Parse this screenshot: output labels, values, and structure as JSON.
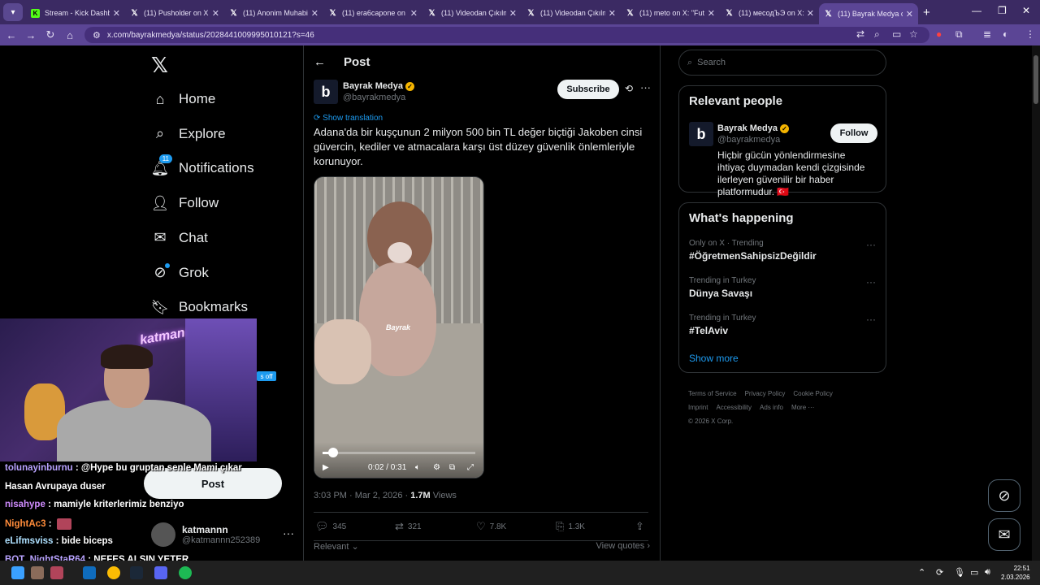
{
  "browser": {
    "tabs": [
      {
        "title": "Stream - Kick Dashbo",
        "favicon": "kick-icon",
        "active": false
      },
      {
        "title": "(11) Pusholder on X: '",
        "favicon": "x-icon",
        "active": false
      },
      {
        "title": "(11) Anonim Muhabir",
        "favicon": "x-icon",
        "active": false
      },
      {
        "title": "(11) era6capone on X",
        "favicon": "x-icon",
        "active": false
      },
      {
        "title": "(11) Videodan Çıkılm",
        "favicon": "x-icon",
        "active": false
      },
      {
        "title": "(11) Videodan Çıkılm",
        "favicon": "x-icon",
        "active": false
      },
      {
        "title": "(11) meto on X: \"Futb",
        "favicon": "x-icon",
        "active": false
      },
      {
        "title": "(11) месодЪЭ on X: '",
        "favicon": "x-icon",
        "active": false
      },
      {
        "title": "(11) Bayrak Medya on",
        "favicon": "x-icon",
        "active": true
      }
    ],
    "url": "x.com/bayrakmedya/status/2028441009995010121?s=46"
  },
  "nav": {
    "items": [
      {
        "label": "Home",
        "icon": "home-icon"
      },
      {
        "label": "Explore",
        "icon": "search-icon"
      },
      {
        "label": "Notifications",
        "icon": "bell-icon",
        "badge": "11"
      },
      {
        "label": "Follow",
        "icon": "follow-icon"
      },
      {
        "label": "Chat",
        "icon": "mail-icon"
      },
      {
        "label": "Grok",
        "icon": "grok-icon"
      },
      {
        "label": "Bookmarks",
        "icon": "bookmark-icon"
      }
    ],
    "post_button": "Post",
    "account": {
      "name": "katmannn",
      "handle": "@katmannn252389"
    }
  },
  "post": {
    "header": "Post",
    "author": {
      "name": "Bayrak Medya",
      "handle": "@bayrakmedya",
      "avatar_letter": "b"
    },
    "subscribe": "Subscribe",
    "show_translation": "Show translation",
    "text": "Adana'da bir kuşçunun 2 milyon 500 bin TL değer biçtiği Jakoben cinsi güvercin, kediler ve atmacalara karşı üst düzey güvenlik önlemleriyle korunuyor.",
    "video": {
      "watermark": "Bayrak",
      "time": "0:02 / 0:31",
      "progress": 0.07
    },
    "time": "3:03 PM · Mar 2, 2026 ·",
    "views": "1.7M",
    "views_label": "Views",
    "actions": {
      "replies": "345",
      "reposts": "321",
      "likes": "7.8K",
      "bookmarks": "1.3K"
    },
    "relevant": "Relevant",
    "view_quotes": "View quotes"
  },
  "right": {
    "search_placeholder": "Search",
    "relevant_people": {
      "title": "Relevant people",
      "name": "Bayrak Medya",
      "handle": "@bayrakmedya",
      "follow": "Follow",
      "bio": "Hiçbir gücün yönlendirmesine ihtiyaç duymadan kendi çizgisinde ilerleyen güvenilir bir haber platformudur. 🇹🇷"
    },
    "happening": {
      "title": "What's happening",
      "trends": [
        {
          "context": "Only on X · Trending",
          "name": "#ÖğretmenSahipsizDeğildir"
        },
        {
          "context": "Trending in Turkey",
          "name": "Dünya Savaşı"
        },
        {
          "context": "Trending in Turkey",
          "name": "#TelAviv"
        }
      ],
      "show_more": "Show more"
    },
    "footer": {
      "links": [
        "Terms of Service",
        "Privacy Policy",
        "Cookie Policy",
        "Imprint",
        "Accessibility",
        "Ads info",
        "More ···"
      ],
      "copyright": "© 2026 X Corp."
    }
  },
  "overlay": {
    "webcam_sign": "katman",
    "off_label": "s off",
    "chat": [
      {
        "user": "tolunayinburnu",
        "color": "#b9a3ff",
        "msg": ": @Hype bu gruptan senle Mami çıkar"
      },
      {
        "user": "",
        "color": "#ffffff",
        "msg": "Hasan Avrupaya duser"
      },
      {
        "user": "nisahype",
        "color": "#d08cff",
        "msg": ": mamiyle kriterlerimiz benziyo"
      },
      {
        "user": "NightAc3",
        "color": "#ff8c3a",
        "msg": ":"
      },
      {
        "user": "eLifmsviss",
        "color": "#aee0ff",
        "msg": ": bide biceps"
      },
      {
        "user": "BOT_NightStaR64",
        "color": "#b9a3ff",
        "msg": ": NEFES ALSIN YETER"
      }
    ]
  },
  "taskbar": {
    "clock_time": "22:51",
    "clock_date": "2.03.2026"
  },
  "colors": {
    "x_blue": "#1d9bf0",
    "browser_purple": "#5b4595"
  }
}
